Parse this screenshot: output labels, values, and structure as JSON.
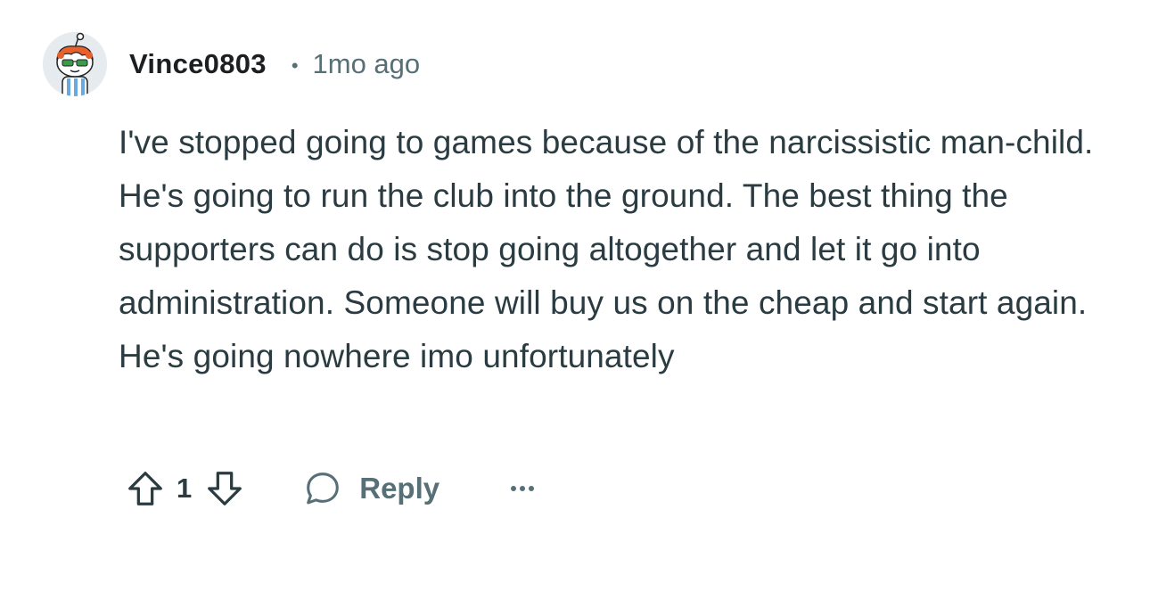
{
  "comment": {
    "avatar_icon": "snoo-avatar",
    "username": "Vince0803",
    "separator": "•",
    "timestamp": "1mo ago",
    "body": "I've stopped going to games because of the narcissistic man-child. He's going to run the club into the ground. The best thing the supporters can do is stop going altogether and let it go into administration. Someone will buy us on the cheap and start again. He's going nowhere imo unfortunately"
  },
  "actions": {
    "upvote_icon": "upvote-arrow-icon",
    "vote_count": "1",
    "downvote_icon": "downvote-arrow-icon",
    "reply_icon": "speech-bubble-icon",
    "reply_label": "Reply",
    "more_icon": "ellipsis-icon"
  },
  "colors": {
    "text_primary": "#1c1f21",
    "text_body": "#2a3c42",
    "text_secondary": "#576f76",
    "icon": "#2a3c42"
  }
}
